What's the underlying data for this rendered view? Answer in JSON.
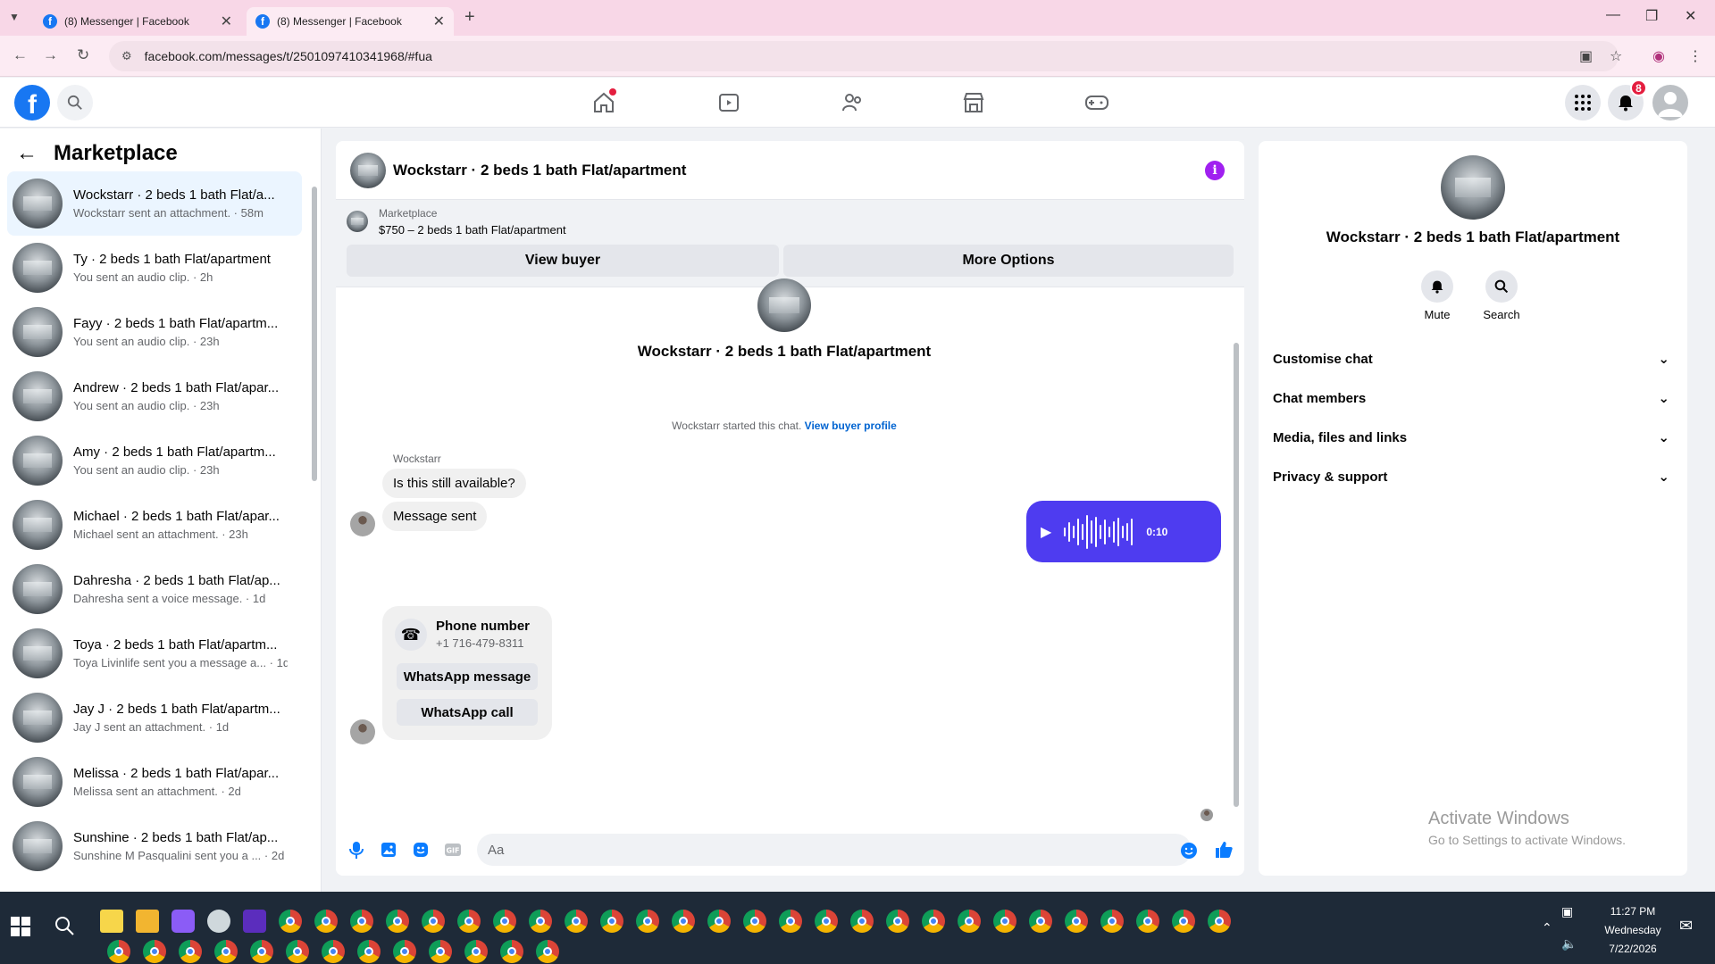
{
  "browser": {
    "tabs": [
      {
        "title": "(8) Messenger | Facebook",
        "active": false
      },
      {
        "title": "(8) Messenger | Facebook",
        "active": true
      }
    ],
    "url": "facebook.com/messages/t/2501097410341968/#fua"
  },
  "fb_nav": {
    "notifications_count": "8"
  },
  "sidebar": {
    "title": "Marketplace",
    "conversations": [
      {
        "name": "Wockstarr · 2 beds 1 bath Flat/a...",
        "sub": "Wockstarr sent an attachment. · 58m",
        "selected": true
      },
      {
        "name": "Ty · 2 beds 1 bath Flat/apartment",
        "sub": "You sent an audio clip. · 2h"
      },
      {
        "name": "Fayy · 2 beds 1 bath Flat/apartm...",
        "sub": "You sent an audio clip. · 23h"
      },
      {
        "name": "Andrew · 2 beds 1 bath Flat/apar...",
        "sub": "You sent an audio clip. · 23h"
      },
      {
        "name": "Amy · 2 beds 1 bath Flat/apartm...",
        "sub": "You sent an audio clip. · 23h"
      },
      {
        "name": "Michael · 2 beds 1 bath Flat/apar...",
        "sub": "Michael sent an attachment. · 23h"
      },
      {
        "name": "Dahresha · 2 beds 1 bath Flat/ap...",
        "sub": "Dahresha sent a voice message. · 1d"
      },
      {
        "name": "Toya · 2 beds 1 bath Flat/apartm...",
        "sub": "Toya Livinlife sent you a message a... · 1d"
      },
      {
        "name": "Jay J · 2 beds 1 bath Flat/apartm...",
        "sub": "Jay J sent an attachment. · 1d"
      },
      {
        "name": "Melissa · 2 beds 1 bath Flat/apar...",
        "sub": "Melissa sent an attachment. · 2d"
      },
      {
        "name": "Sunshine · 2 beds 1 bath Flat/ap...",
        "sub": "Sunshine M Pasqualini sent you a ... · 2d"
      }
    ]
  },
  "chat": {
    "title": "Wockstarr · 2 beds 1 bath Flat/apartment",
    "marketplace_label": "Marketplace",
    "listing": "$750 – 2 beds 1 bath Flat/apartment",
    "view_buyer": "View buyer",
    "more_options": "More Options",
    "started_text": "Wockstarr started this chat.",
    "view_buyer_profile": "View buyer profile",
    "sender": "Wockstarr",
    "msg1": "Is this still available?",
    "msg2": "Message sent",
    "voice_duration": "0:10",
    "msg3": "7164798311",
    "phone_title": "Phone number",
    "phone_number": "+1 716-479-8311",
    "whatsapp_message": "WhatsApp message",
    "whatsapp_call": "WhatsApp call",
    "composer_placeholder": "Aa",
    "accent_color": "#4e3cf0"
  },
  "info": {
    "name": "Wockstarr · 2 beds 1 bath Flat/apartment",
    "mute": "Mute",
    "search": "Search",
    "sections": [
      "Customise chat",
      "Chat members",
      "Media, files and links",
      "Privacy & support"
    ],
    "activate_title": "Activate Windows",
    "activate_sub": "Go to Settings to activate Windows."
  },
  "taskbar": {
    "time": "11:27 PM",
    "day": "Wednesday",
    "date": "7/22/2026"
  }
}
